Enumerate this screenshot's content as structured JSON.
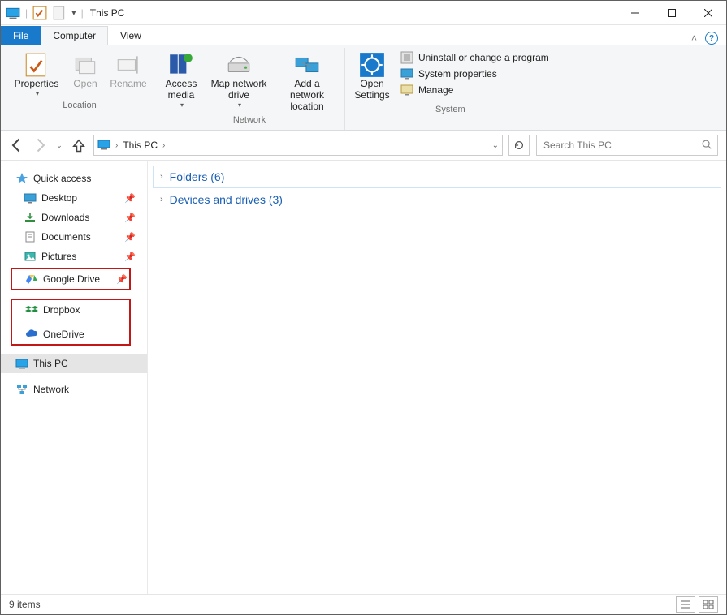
{
  "window": {
    "title": "This PC"
  },
  "tabs": {
    "file": "File",
    "computer": "Computer",
    "view": "View"
  },
  "ribbon": {
    "location": {
      "name": "Location",
      "properties": "Properties",
      "open": "Open",
      "rename": "Rename"
    },
    "network": {
      "name": "Network",
      "access_media": "Access media",
      "map_drive": "Map network drive",
      "add_location": "Add a network location"
    },
    "settings": {
      "open_settings": "Open Settings"
    },
    "system": {
      "name": "System",
      "uninstall": "Uninstall or change a program",
      "properties": "System properties",
      "manage": "Manage"
    }
  },
  "address": {
    "root": "This PC"
  },
  "search": {
    "placeholder": "Search This PC"
  },
  "tree": {
    "quick_access": "Quick access",
    "desktop": "Desktop",
    "downloads": "Downloads",
    "documents": "Documents",
    "pictures": "Pictures",
    "google_drive": "Google Drive",
    "dropbox": "Dropbox",
    "onedrive": "OneDrive",
    "this_pc": "This PC",
    "network": "Network"
  },
  "sections": {
    "folders": "Folders (6)",
    "devices": "Devices and drives (3)"
  },
  "status": {
    "items": "9 items"
  }
}
